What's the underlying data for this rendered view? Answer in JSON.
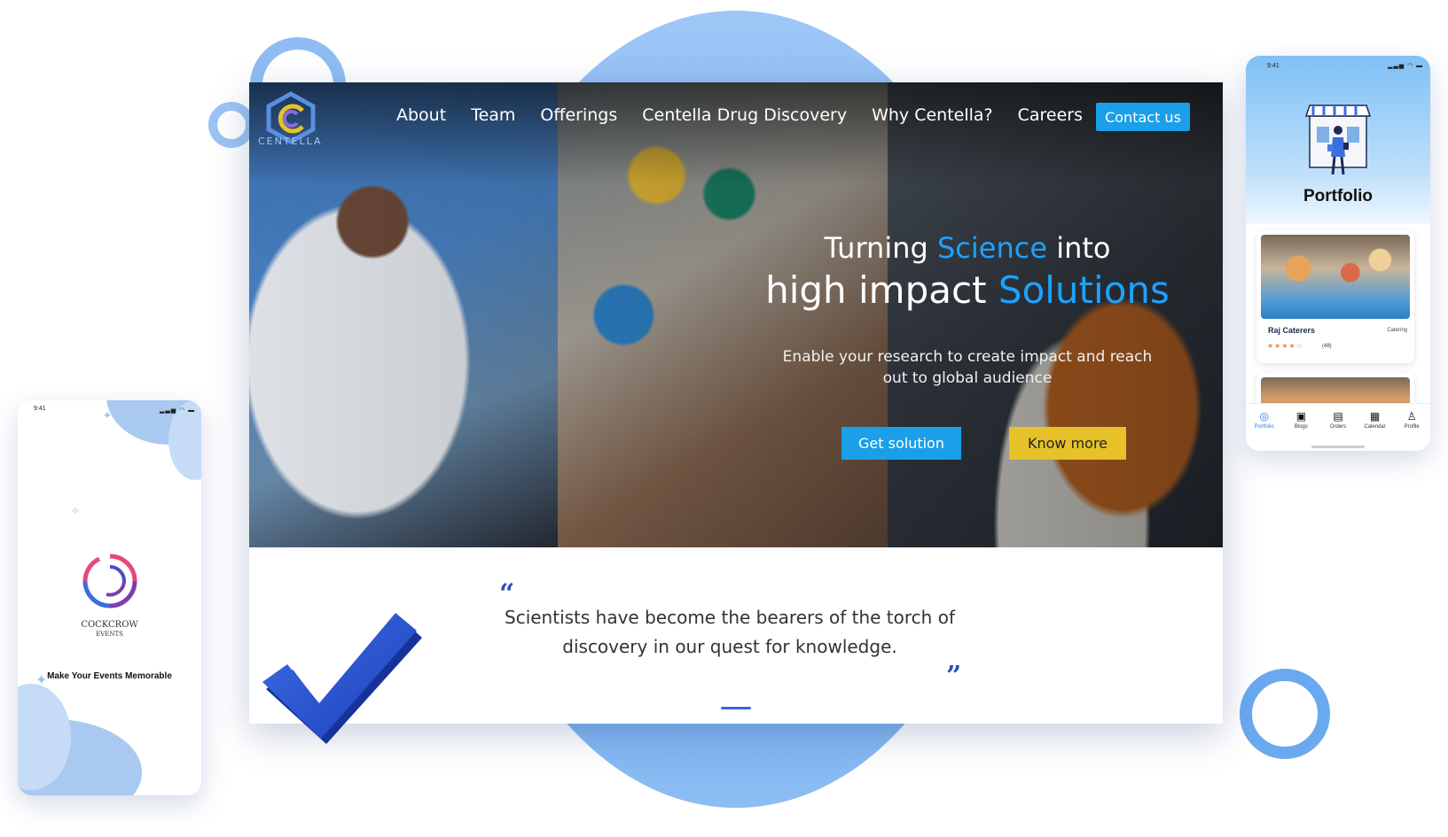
{
  "site": {
    "logo_text": "CENTELLA",
    "nav": [
      "About",
      "Team",
      "Offerings",
      "Centella Drug Discovery",
      "Why Centella?",
      "Careers"
    ],
    "contact_label": "Contact us",
    "headline": {
      "line1_pre": "Turning ",
      "line1_accent": "Science",
      "line1_post": " into",
      "line2_pre": "high impact ",
      "line2_accent": "Solutions"
    },
    "subtext": "Enable your research to create impact and reach out to global audience",
    "primary_button": "Get solution",
    "secondary_button": "Know more",
    "quote_open": "“",
    "quote": "Scientists have become the bearers of the torch of discovery in our quest for knowledge.",
    "quote_close": "”"
  },
  "phone_left": {
    "time": "9:41",
    "logo_line1": "COCKCROW",
    "logo_line2": "EVENTS",
    "tagline": "Make Your Events Memorable"
  },
  "phone_right": {
    "time": "9:41",
    "title": "Portfolio",
    "card": {
      "name": "Raj Caterers",
      "category": "Catering",
      "stars": "★★★★☆",
      "rating": 4.5,
      "count": "(48)"
    },
    "tabs": [
      {
        "label": "Portfolio",
        "icon": "portfolio-icon",
        "active": true
      },
      {
        "label": "Blogs",
        "icon": "blogs-icon",
        "active": false
      },
      {
        "label": "Orders",
        "icon": "orders-icon",
        "active": false
      },
      {
        "label": "Calendar",
        "icon": "calendar-icon",
        "active": false
      },
      {
        "label": "Profile",
        "icon": "profile-icon",
        "active": false
      }
    ]
  },
  "colors": {
    "accent_blue": "#1a9fe8",
    "accent_yellow": "#e6c12a",
    "quote_blue": "#2c4fbd"
  }
}
